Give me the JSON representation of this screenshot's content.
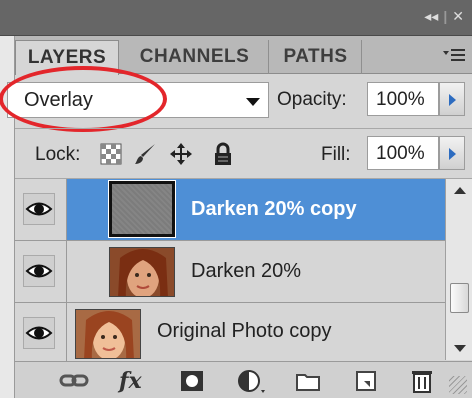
{
  "window": {
    "controls": {
      "collapse": "◂◂",
      "close": "✕"
    }
  },
  "tabs": [
    {
      "label": "LAYERS",
      "active": true
    },
    {
      "label": "CHANNELS",
      "active": false
    },
    {
      "label": "PATHS",
      "active": false
    }
  ],
  "panel_menu_icon": "panel-menu-icon",
  "blend_mode": {
    "value": "Overlay",
    "annotation_color": "#e3262b"
  },
  "opacity": {
    "label": "Opacity:",
    "value": "100%"
  },
  "lock": {
    "label": "Lock:",
    "icons": [
      "lock-transparent-pixels-icon",
      "lock-image-pixels-icon",
      "lock-position-icon",
      "lock-all-icon"
    ]
  },
  "fill": {
    "label": "Fill:",
    "value": "100%"
  },
  "layers": [
    {
      "name": "Darken 20% copy",
      "visible": true,
      "selected": true,
      "thumbnail": "gray-fill"
    },
    {
      "name": "Darken 20%",
      "visible": true,
      "selected": false,
      "thumbnail": "photo"
    },
    {
      "name": "Original Photo copy",
      "visible": true,
      "selected": false,
      "thumbnail": "photo"
    }
  ],
  "footer_icons": [
    "link-layers-icon",
    "fx-icon",
    "add-mask-icon",
    "adjustment-layer-icon",
    "new-group-icon",
    "new-layer-icon",
    "trash-icon"
  ],
  "footer": {
    "fx_label": "fx"
  },
  "colors": {
    "selection": "#4e8fd6",
    "panel": "#d6d6d6"
  }
}
